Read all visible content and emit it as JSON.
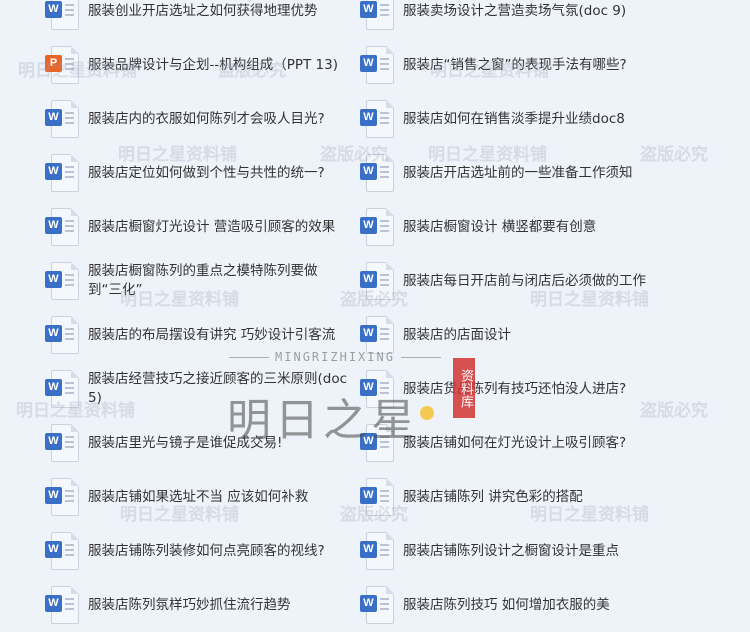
{
  "files": [
    {
      "type": "W",
      "name": "服装创业开店选址之如何获得地理优势"
    },
    {
      "type": "W",
      "name": "服装卖场设计之营造卖场气氛(doc 9)"
    },
    {
      "type": "P",
      "name": "服装品牌设计与企划--机构组成（PPT 13)"
    },
    {
      "type": "W",
      "name": "服装店“销售之窗”的表现手法有哪些?"
    },
    {
      "type": "W",
      "name": "服装店内的衣服如何陈列才会吸人目光?"
    },
    {
      "type": "W",
      "name": "服装店如何在销售淡季提升业绩doc8"
    },
    {
      "type": "W",
      "name": "服装店定位如何做到个性与共性的统一?"
    },
    {
      "type": "W",
      "name": "服装店开店选址前的一些准备工作须知"
    },
    {
      "type": "W",
      "name": "服装店橱窗灯光设计 营造吸引顾客的效果"
    },
    {
      "type": "W",
      "name": "服装店橱窗设计 横竖都要有创意"
    },
    {
      "type": "W",
      "name": "服装店橱窗陈列的重点之模特陈列要做到“三化”"
    },
    {
      "type": "W",
      "name": "服装店每日开店前与闭店后必须做的工作"
    },
    {
      "type": "W",
      "name": "服装店的布局摆设有讲究 巧妙设计引客流"
    },
    {
      "type": "W",
      "name": "服装店的店面设计"
    },
    {
      "type": "W",
      "name": "服装店经营技巧之接近顾客的三米原则(doc 5)"
    },
    {
      "type": "W",
      "name": "服装店货品陈列有技巧还怕没人进店?"
    },
    {
      "type": "W",
      "name": "服装店里光与镜子是谁促成交易!"
    },
    {
      "type": "W",
      "name": "服装店铺如何在灯光设计上吸引顾客?"
    },
    {
      "type": "W",
      "name": "服装店铺如果选址不当 应该如何补救"
    },
    {
      "type": "W",
      "name": "服装店铺陈列 讲究色彩的搭配"
    },
    {
      "type": "W",
      "name": "服装店铺陈列装修如何点亮顾客的视线?"
    },
    {
      "type": "W",
      "name": "服装店铺陈列设计之橱窗设计是重点"
    },
    {
      "type": "W",
      "name": "服装店陈列氛样巧妙抓住流行趋势"
    },
    {
      "type": "W",
      "name": "服装店陈列技巧 如何增加衣服的美"
    }
  ],
  "watermarks": {
    "site": "明日之星资料铺",
    "notice": "盗版必究"
  },
  "logo": {
    "pinyin": "MINGRIZHIXING",
    "name": "明日之星",
    "seal": "资料库"
  },
  "colors": {
    "background": "#eef3fa",
    "word_badge": "#3a6fc7",
    "ppt_badge": "#e8652a",
    "seal": "#d23232"
  }
}
